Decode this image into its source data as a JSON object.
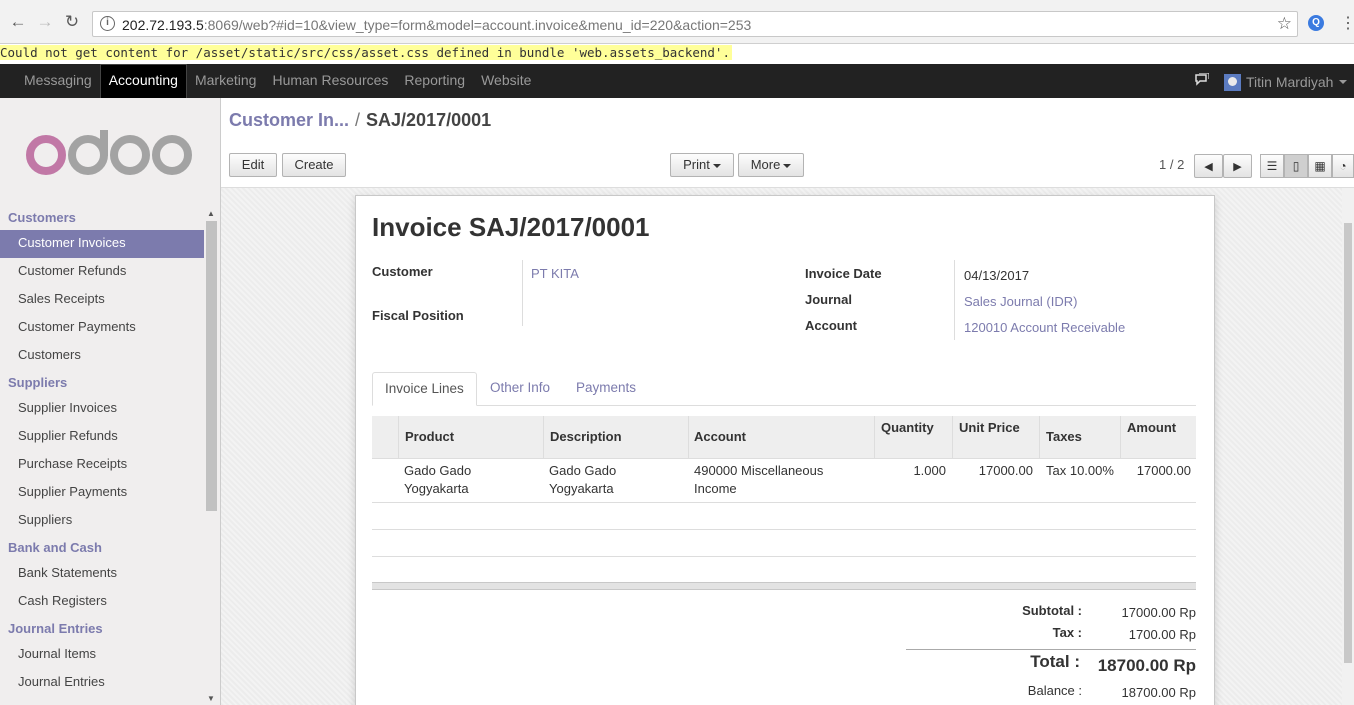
{
  "browser": {
    "url_host": "202.72.193.5",
    "url_rest": ":8069/web?#id=10&view_type=form&model=account.invoice&menu_id=220&action=253"
  },
  "error_banner": "Could not get content for /asset/static/src/css/asset.css defined in bundle 'web.assets_backend'.",
  "topbar": {
    "menu": [
      "Messaging",
      "Accounting",
      "Marketing",
      "Human Resources",
      "Reporting",
      "Website"
    ],
    "active": "Accounting",
    "user": "Titin Mardiyah"
  },
  "logo_text": "odoo",
  "sidebar": {
    "sections": [
      {
        "title": "Customers",
        "items": [
          "Customer Invoices",
          "Customer Refunds",
          "Sales Receipts",
          "Customer Payments",
          "Customers"
        ]
      },
      {
        "title": "Suppliers",
        "items": [
          "Supplier Invoices",
          "Supplier Refunds",
          "Purchase Receipts",
          "Supplier Payments",
          "Suppliers"
        ]
      },
      {
        "title": "Bank and Cash",
        "items": [
          "Bank Statements",
          "Cash Registers"
        ]
      },
      {
        "title": "Journal Entries",
        "items": [
          "Journal Items",
          "Journal Entries"
        ]
      }
    ],
    "active_item": "Customer Invoices"
  },
  "breadcrumb": {
    "parent": "Customer In...",
    "separator": "/",
    "current": "SAJ/2017/0001"
  },
  "buttons": {
    "edit": "Edit",
    "create": "Create",
    "print": "Print",
    "more": "More"
  },
  "pager": "1 / 2",
  "form": {
    "title": "Invoice SAJ/2017/0001",
    "customer_label": "Customer",
    "customer_value": "PT KITA",
    "fiscal_position_label": "Fiscal Position",
    "invoice_date_label": "Invoice Date",
    "invoice_date_value": "04/13/2017",
    "journal_label": "Journal",
    "journal_value": "Sales Journal (IDR)",
    "account_label": "Account",
    "account_value": "120010 Account Receivable"
  },
  "tabs": [
    "Invoice Lines",
    "Other Info",
    "Payments"
  ],
  "table": {
    "headers": {
      "product": "Product",
      "description": "Description",
      "account": "Account",
      "quantity": "Quantity",
      "unit_price": "Unit Price",
      "taxes": "Taxes",
      "amount": "Amount"
    },
    "rows": [
      {
        "product": "Gado Gado Yogyakarta",
        "description": "Gado Gado Yogyakarta",
        "account": "490000 Miscellaneous Income",
        "quantity": "1.000",
        "unit_price": "17000.00",
        "taxes": "Tax 10.00%",
        "amount": "17000.00"
      }
    ]
  },
  "totals": {
    "subtotal_label": "Subtotal :",
    "subtotal_value": "17000.00 Rp",
    "tax_label": "Tax :",
    "tax_value": "1700.00 Rp",
    "total_label": "Total :",
    "total_value": "18700.00 Rp",
    "balance_label": "Balance :",
    "balance_value": "18700.00 Rp"
  }
}
